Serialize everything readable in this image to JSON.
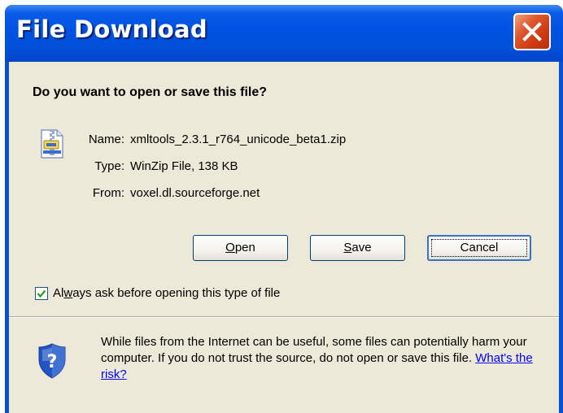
{
  "window": {
    "title": "File Download"
  },
  "question": "Do you want to open or save this file?",
  "file": {
    "name_label": "Name:",
    "name_value": "xmltools_2.3.1_r764_unicode_beta1.zip",
    "type_label": "Type:",
    "type_value": "WinZip File, 138 KB",
    "from_label": "From:",
    "from_value": "voxel.dl.sourceforge.net"
  },
  "buttons": {
    "open": {
      "key": "O",
      "rest": "pen"
    },
    "save": {
      "key": "S",
      "rest": "ave"
    },
    "cancel": "Cancel"
  },
  "checkbox": {
    "checked": true,
    "label_pre": "Al",
    "label_key": "w",
    "label_post": "ays ask before opening this type of file"
  },
  "warning": {
    "text": "While files from the Internet can be useful, some files can potentially harm your computer. If you do not trust the source, do not open or save this file.",
    "link": "What's the risk?"
  },
  "colors": {
    "titlebar": "#0054e3",
    "close_button": "#d94a22",
    "dialog_background": "#ece9d8",
    "link": "#0000ff"
  },
  "icons": [
    "close-icon",
    "zip-file-icon",
    "checkmark-icon",
    "security-shield-icon"
  ]
}
